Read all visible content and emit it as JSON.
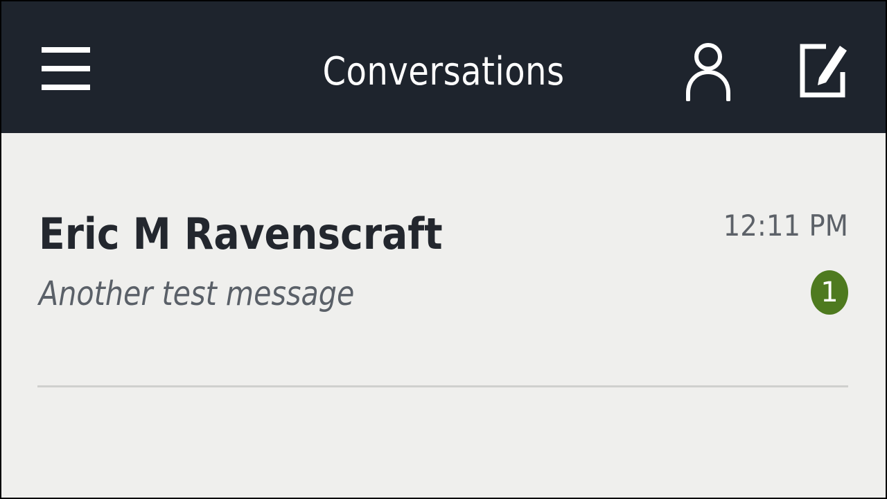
{
  "app_bar": {
    "title": "Conversations",
    "menu_icon": "hamburger-menu-icon",
    "contacts_icon": "person-icon",
    "compose_icon": "compose-icon",
    "background_color": "#1e242d",
    "icon_color": "#ffffff"
  },
  "conversations": [
    {
      "name": "Eric M Ravenscraft",
      "preview": "Another test message",
      "time": "12:11 PM",
      "unread_count": "1",
      "badge_color": "#4e7a1f"
    }
  ],
  "list_background_color": "#efefed"
}
